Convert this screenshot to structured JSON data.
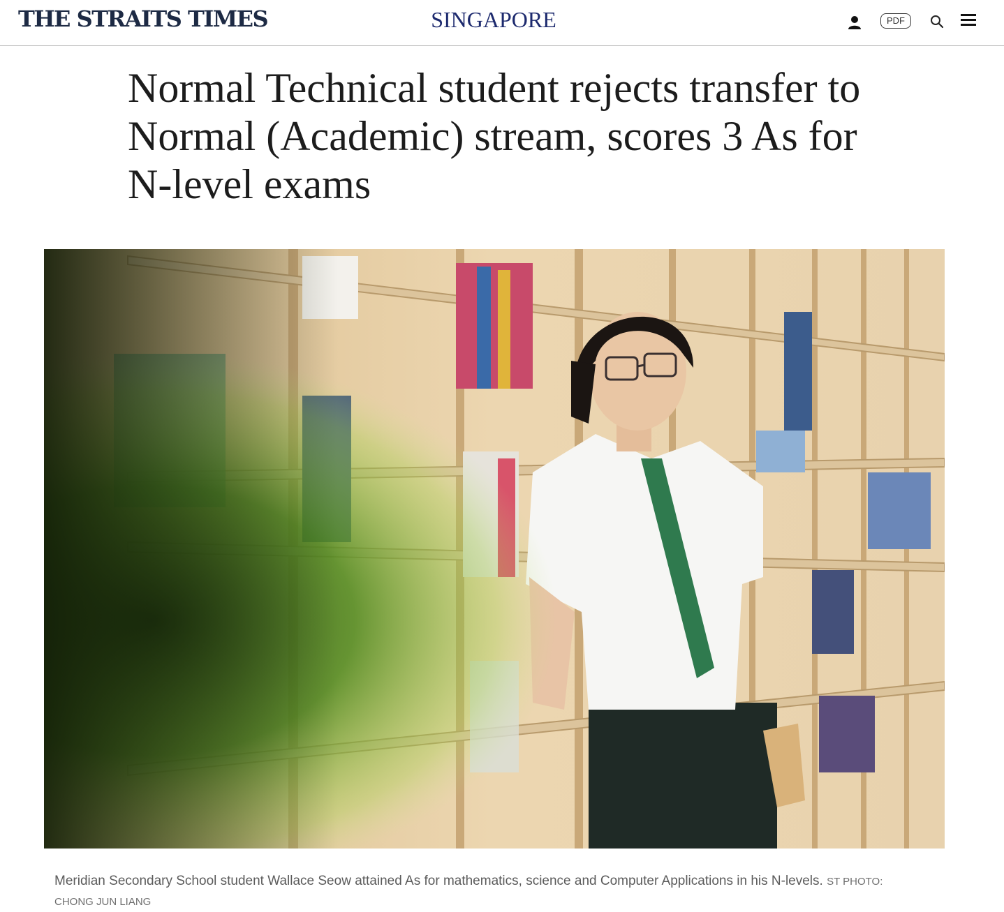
{
  "header": {
    "logo": "THE STRAITS TIMES",
    "section": "SINGAPORE",
    "pdf_label": "PDF",
    "icons": [
      "user-icon",
      "search-icon",
      "hamburger-menu-icon"
    ]
  },
  "article": {
    "headline": "Normal Technical student rejects transfer to Normal (Academic) stream, scores 3 As for N-level exams",
    "caption": "Meridian Secondary School student Wallace Seow attained As for mathematics, science and Computer Applications in his N-levels.",
    "credit": "ST PHOTO: CHONG JUN LIANG"
  },
  "colors": {
    "brand_navy": "#1d2a44",
    "section_blue": "#1d2a6e",
    "text": "#1c1c1c",
    "caption": "#5b5b5b"
  }
}
